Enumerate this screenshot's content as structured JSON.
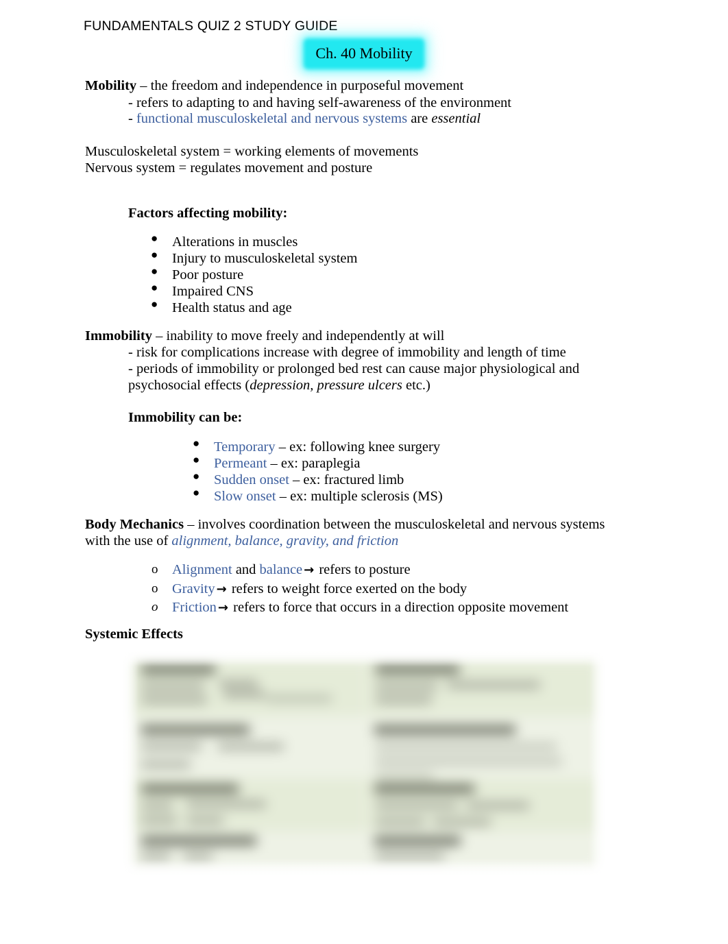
{
  "document": {
    "header": "FUNDAMENTALS QUIZ 2 STUDY GUIDE",
    "chapter_title": "Ch. 40 Mobility",
    "chapter_highlight_color": "#22e8f0",
    "accent_blue": "#3d5f9e"
  },
  "mobility": {
    "term": "Mobility",
    "dash_def": " – the freedom and independence in purposeful movement",
    "sub1": "- refers to adapting to and having self-awareness of the environment",
    "sub2_dash": "- ",
    "sub2_blue": "functional musculoskeletal and nervous systems",
    "sub2_mid": " are ",
    "sub2_ital": "essential",
    "line_msk": "Musculoskeletal system = working elements of movements",
    "line_nerv": "Nervous system = regulates movement and posture"
  },
  "factors": {
    "heading": "Factors affecting mobility:",
    "items": [
      "Alterations in muscles",
      "Injury to musculoskeletal system",
      "Poor posture",
      "Impaired CNS",
      "Health status and age"
    ]
  },
  "immobility": {
    "term": "Immobility",
    "dash_def": " – inability to move freely and independently at will",
    "sub1": "- risk for complications increase with degree of immobility and length of time",
    "sub2_a": "- periods of immobility or prolonged bed rest can cause major physiological and",
    "sub2_b_pre": "psychosocial effects (",
    "sub2_b_ital": "depression, pressure ulcers",
    "sub2_b_post": " etc.)",
    "can_be_heading": "Immobility can be:",
    "can_be_items": [
      {
        "term": "Temporary",
        "rest": " – ex: following knee surgery"
      },
      {
        "term": "Permeant",
        "rest": " – ex: paraplegia"
      },
      {
        "term": "Sudden onset",
        "rest": " – ex: fractured limb"
      },
      {
        "term": "Slow onset",
        "rest": " – ex: multiple sclerosis (MS)"
      }
    ]
  },
  "body_mechanics": {
    "term": "Body Mechanics",
    "line1_rest": " – involves coordination between the musculoskeletal and nervous systems",
    "line2_pre": "with the use of ",
    "line2_blue_ital": "alignment, balance, gravity, and friction",
    "items": [
      {
        "marker": "o",
        "marker_italic": false,
        "term": "Alignment",
        "mid": " and ",
        "term2": "balance",
        "arrow": "→",
        "rest": " refers to posture"
      },
      {
        "marker": "o",
        "marker_italic": false,
        "term": "Gravity",
        "mid": "",
        "term2": "",
        "arrow": "→",
        "rest": " refers to weight force exerted on the body"
      },
      {
        "marker": "o",
        "marker_italic": true,
        "term": "Friction",
        "mid": "",
        "term2": "",
        "arrow": "→",
        "rest": " refers to force that occurs in a direction opposite movement"
      }
    ]
  },
  "systemic": {
    "heading": "Systemic Effects",
    "image_note": "blurred illustration",
    "image_bg_color": "#eef2e6"
  }
}
